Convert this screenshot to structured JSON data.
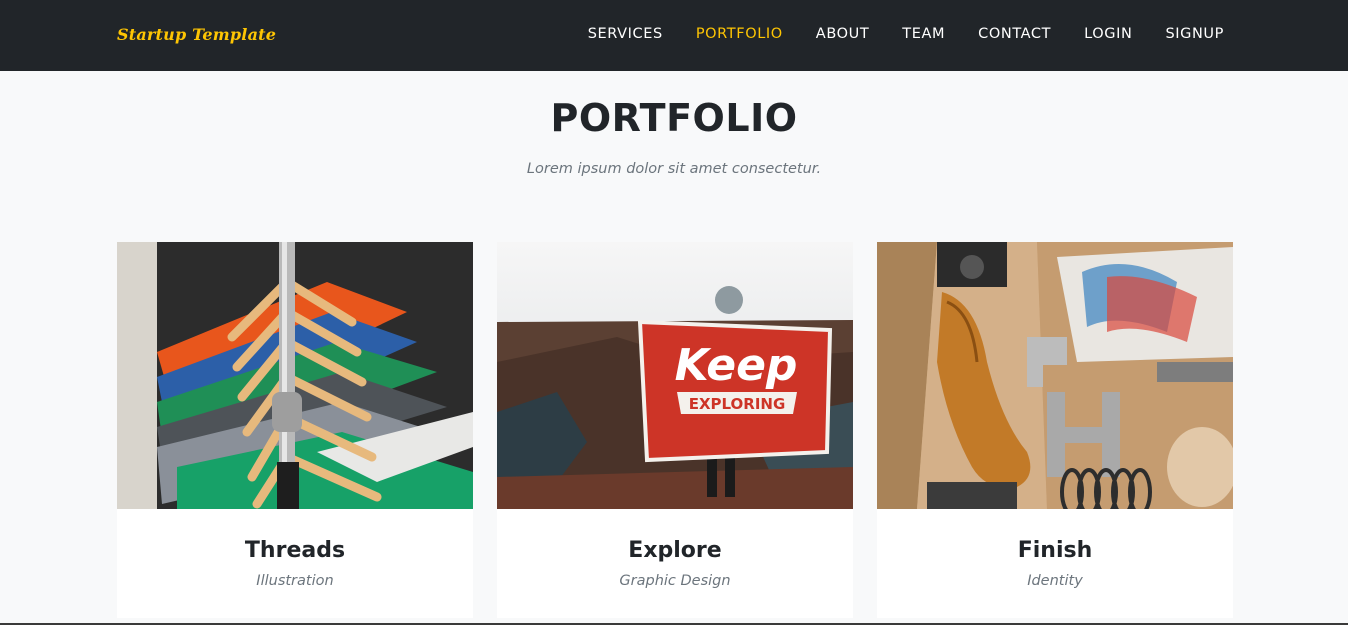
{
  "navbar": {
    "brand": "Startup Template",
    "links": [
      {
        "label": "SERVICES",
        "active": false
      },
      {
        "label": "PORTFOLIO",
        "active": true
      },
      {
        "label": "ABOUT",
        "active": false
      },
      {
        "label": "TEAM",
        "active": false
      },
      {
        "label": "CONTACT",
        "active": false
      },
      {
        "label": "LOGIN",
        "active": false
      },
      {
        "label": "SIGNUP",
        "active": false
      }
    ]
  },
  "portfolio": {
    "title": "PORTFOLIO",
    "subtitle": "Lorem ipsum dolor sit amet consectetur.",
    "items": [
      {
        "title": "Threads",
        "category": "Illustration",
        "image": "clothes-rack-image"
      },
      {
        "title": "Explore",
        "category": "Graphic Design",
        "image": "keep-exploring-flag-image",
        "image_text_1": "Keep",
        "image_text_2": "EXPLORING"
      },
      {
        "title": "Finish",
        "category": "Identity",
        "image": "workshop-letters-image"
      }
    ]
  },
  "colors": {
    "navbar_bg": "#212529",
    "accent": "#fec503",
    "page_bg": "#f8f9fa",
    "heading": "#212529",
    "muted": "#6c757d"
  }
}
